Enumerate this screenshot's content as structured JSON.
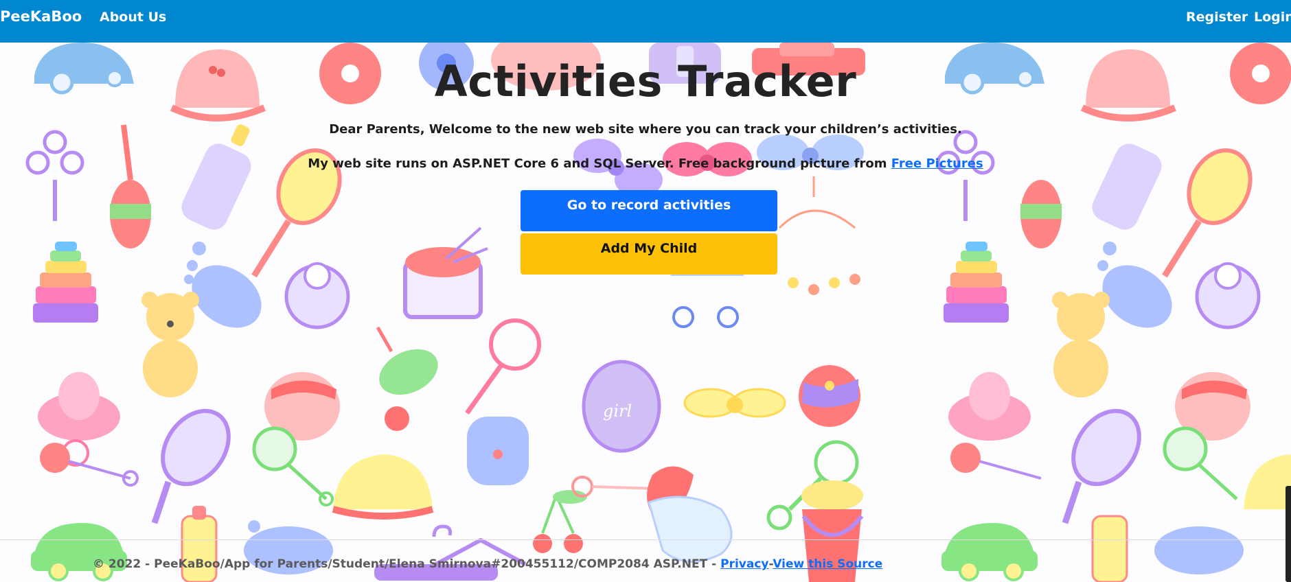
{
  "navbar": {
    "brand": "PeeKaBoo",
    "about": "About Us",
    "register": "Register",
    "login": "Login",
    "color": "#0087cf"
  },
  "main": {
    "title": "Activities Tracker",
    "welcome": "Dear Parents, Welcome to the new web site where you can track your children’s activities.",
    "stack_text": "My web site runs on ASP.NET Core 6 and SQL Server. Free background picture from",
    "pictures_link": "Free Pictures",
    "record_button": "Go to record activities",
    "add_child_button": "Add My Child"
  },
  "footer": {
    "text": "© 2022 - PeeKaBoo/App for Parents/Student/Elena Smirnova#200455112/COMP2084 ASP.NET -",
    "privacy": "Privacy",
    "separator": "-",
    "source": "View this Source"
  },
  "colors": {
    "primary": "#0d6efd",
    "warning": "#ffc107"
  },
  "background_icons": [
    "car-icon",
    "flower-icon",
    "baby-bottle-icon",
    "rattle-icon",
    "mirror-icon",
    "pyramid-toy-icon",
    "teddy-bear-icon",
    "footprint-icon",
    "bib-icon",
    "drum-icon",
    "pacifier-icon",
    "spinning-top-icon",
    "ball-icon",
    "bow-icon",
    "hat-icon",
    "socks-icon",
    "safety-pin-icon",
    "cherry-icon",
    "hanger-icon",
    "bucket-icon",
    "mobile-icon",
    "stroller-icon"
  ]
}
